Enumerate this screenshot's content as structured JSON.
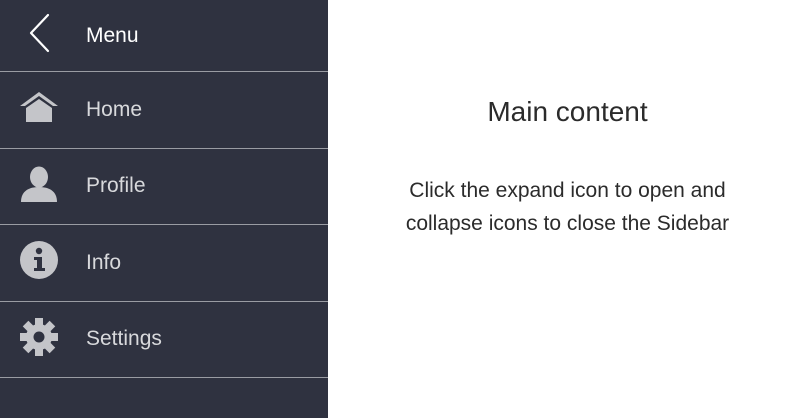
{
  "sidebar": {
    "header": {
      "title": "Menu",
      "back_icon": "chevron-left-icon"
    },
    "items": [
      {
        "label": "Home",
        "icon": "home-icon"
      },
      {
        "label": "Profile",
        "icon": "user-icon"
      },
      {
        "label": "Info",
        "icon": "info-icon"
      },
      {
        "label": "Settings",
        "icon": "gear-icon"
      }
    ],
    "colors": {
      "background": "#2f3240",
      "text": "#d8d9dc",
      "icon": "#c4c5c9",
      "divider": "#9a9ca3"
    }
  },
  "main": {
    "title": "Main content",
    "description": "Click the expand icon to open and collapse icons to close the Sidebar"
  }
}
